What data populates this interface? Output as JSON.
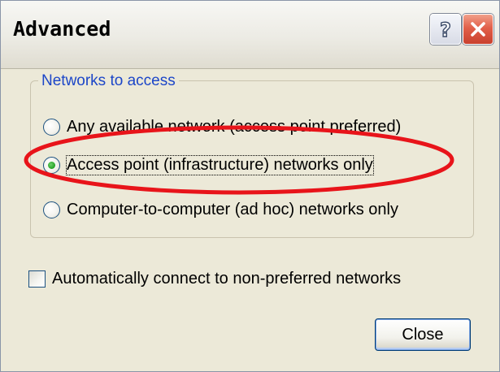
{
  "window": {
    "title": "Advanced"
  },
  "titlebar_buttons": {
    "help_icon": "question-mark-icon",
    "close_icon": "x-icon"
  },
  "networks_group": {
    "legend": "Networks to access",
    "options": [
      {
        "label": "Any available network (access point preferred)",
        "checked": false
      },
      {
        "label": "Access point (infrastructure) networks only",
        "checked": true
      },
      {
        "label": "Computer-to-computer (ad hoc) networks only",
        "checked": false
      }
    ]
  },
  "auto_connect": {
    "label": "Automatically connect to non-preferred networks",
    "checked": false
  },
  "footer": {
    "close_label": "Close"
  },
  "colors": {
    "group_legend": "#1c46c8",
    "annotation_ellipse": "#e8141a",
    "close_titlebar_button": "#d9533c",
    "dialog_background": "#ece9d8"
  }
}
